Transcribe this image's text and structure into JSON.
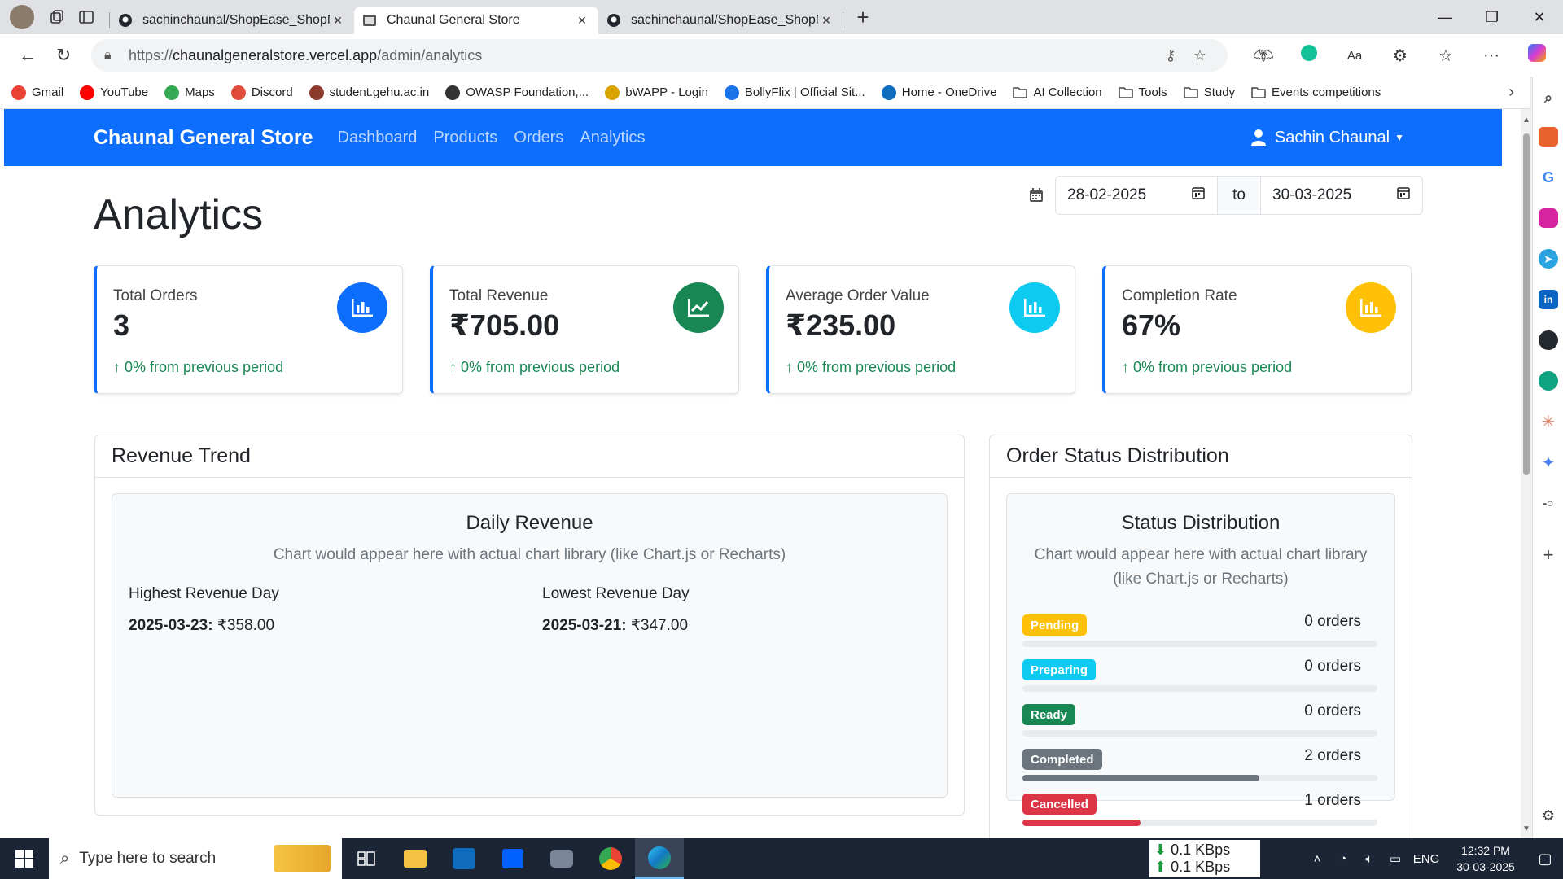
{
  "browser": {
    "tabs": [
      {
        "title": "sachinchaunal/ShopEase_ShopMa",
        "close": "×",
        "icon": "github-icon"
      },
      {
        "title": "Chaunal General Store",
        "close": "×",
        "icon": "store-icon"
      },
      {
        "title": "sachinchaunal/ShopEase_ShopMa",
        "close": "×",
        "icon": "github-icon"
      }
    ],
    "new_tab": "+",
    "url_prefix": "https://",
    "url_host": "chaunalgeneralstore.vercel.app",
    "url_path": "/admin/analytics",
    "bookmarks": [
      {
        "label": "Gmail",
        "icon": "gmail-icon",
        "color": "#ea4335"
      },
      {
        "label": "YouTube",
        "icon": "youtube-icon",
        "color": "#ff0000"
      },
      {
        "label": "Maps",
        "icon": "maps-icon",
        "color": "#34a853"
      },
      {
        "label": "Discord",
        "icon": "discord-icon",
        "color": "#e04b3a"
      },
      {
        "label": "student.gehu.ac.in",
        "icon": "gehu-icon",
        "color": "#8b3a2b"
      },
      {
        "label": "OWASP Foundation,...",
        "icon": "owasp-icon",
        "color": "#333333"
      },
      {
        "label": "bWAPP - Login",
        "icon": "bwapp-icon",
        "color": "#d9a400"
      },
      {
        "label": "BollyFlix | Official Sit...",
        "icon": "bollyflix-icon",
        "color": "#1a73e8"
      },
      {
        "label": "Home - OneDrive",
        "icon": "onedrive-icon",
        "color": "#0f6cbd"
      },
      {
        "label": "AI Collection",
        "icon": "folder-icon",
        "color": "#444444"
      },
      {
        "label": "Tools",
        "icon": "folder-icon",
        "color": "#444444"
      },
      {
        "label": "Study",
        "icon": "folder-icon",
        "color": "#444444"
      },
      {
        "label": "Events competitions",
        "icon": "folder-icon",
        "color": "#444444"
      }
    ]
  },
  "app": {
    "brand": "Chaunal General Store",
    "nav": [
      "Dashboard",
      "Products",
      "Orders",
      "Analytics"
    ],
    "user": "Sachin Chaunal",
    "accent": "#0d6efd"
  },
  "page": {
    "title": "Analytics",
    "date_from": "28-02-2025",
    "date_sep": "to",
    "date_to": "30-03-2025"
  },
  "stats": [
    {
      "label": "Total Orders",
      "value": "3",
      "change": "↑ 0% from previous period",
      "icon": "bar-chart-icon",
      "color": "#0d6efd"
    },
    {
      "label": "Total Revenue",
      "value": "₹705.00",
      "change": "↑ 0% from previous period",
      "icon": "line-chart-icon",
      "color": "#198754"
    },
    {
      "label": "Average Order Value",
      "value": "₹235.00",
      "change": "↑ 0% from previous period",
      "icon": "bar-chart-icon",
      "color": "#0dcaf0"
    },
    {
      "label": "Completion Rate",
      "value": "67%",
      "change": "↑ 0% from previous period",
      "icon": "bar-chart-icon",
      "color": "#ffc107"
    }
  ],
  "revenue_trend": {
    "header": "Revenue Trend",
    "title": "Daily Revenue",
    "note": "Chart would appear here with actual chart library (like Chart.js or Recharts)",
    "highest_label": "Highest Revenue Day",
    "highest_date": "2025-03-23:",
    "highest_value": "₹358.00",
    "lowest_label": "Lowest Revenue Day",
    "lowest_date": "2025-03-21:",
    "lowest_value": "₹347.00"
  },
  "status_dist": {
    "header": "Order Status Distribution",
    "title": "Status Distribution",
    "note": "Chart would appear here with actual chart library (like Chart.js or Recharts)",
    "rows": [
      {
        "label": "Pending",
        "count": "0 orders",
        "fraction": 0,
        "bg": "#ffc107",
        "fg": "#ffffff"
      },
      {
        "label": "Preparing",
        "count": "0 orders",
        "fraction": 0,
        "bg": "#0dcaf0",
        "fg": "#ffffff"
      },
      {
        "label": "Ready",
        "count": "0 orders",
        "fraction": 0,
        "bg": "#198754",
        "fg": "#ffffff"
      },
      {
        "label": "Completed",
        "count": "2 orders",
        "fraction": 0.667,
        "bg": "#6c757d",
        "fg": "#ffffff"
      },
      {
        "label": "Cancelled",
        "count": "1 orders",
        "fraction": 0.333,
        "bg": "#dc3545",
        "fg": "#ffffff"
      }
    ]
  },
  "taskbar": {
    "search_placeholder": "Type here to search",
    "net_down": "0.1 KBps",
    "net_up": "0.1 KBps",
    "lang": "ENG",
    "time": "12:32 PM",
    "date": "30-03-2025"
  }
}
